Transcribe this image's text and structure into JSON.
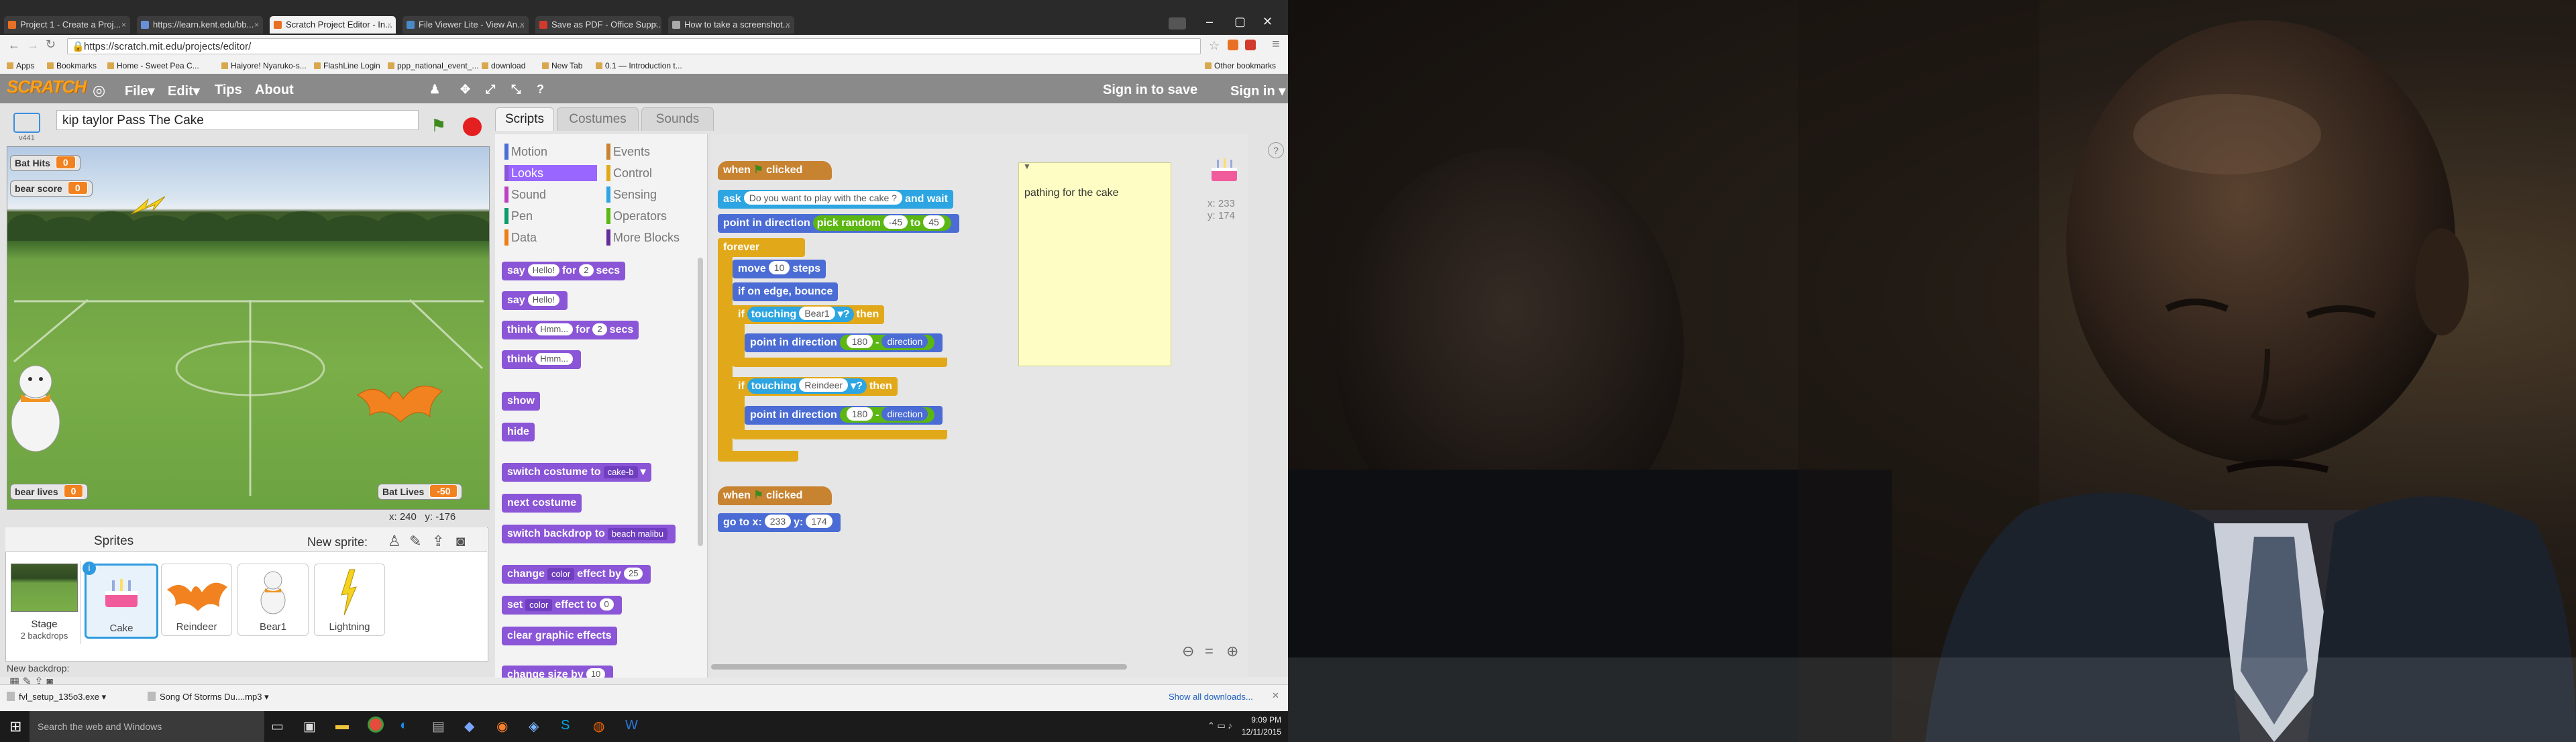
{
  "browser": {
    "tabs": [
      "Project 1 - Create a Proj...",
      "https://learn.kent.edu/bb...",
      "Scratch Project Editor - In...",
      "File Viewer Lite - View An...",
      "Save as PDF - Office Supp...",
      "How to take a screenshot..."
    ],
    "url": "https://scratch.mit.edu/projects/editor/",
    "bookmarks": [
      "Apps",
      "Bookmarks",
      "Home - Sweet Pea C...",
      "Haiyore! Nyaruko-s...",
      "FlashLine Login",
      "ppp_national_event_...",
      "download",
      "New Tab",
      "0.1 — Introduction t..."
    ],
    "other_bookmarks": "Other bookmarks"
  },
  "scratch": {
    "logo": "SCRATCH",
    "menu": [
      "File▾",
      "Edit▾",
      "Tips",
      "About"
    ],
    "sign_in_to_save": "Sign in to save",
    "sign_in": "Sign in ▾",
    "project_title": "kip taylor Pass The Cake",
    "version": "v441",
    "monitors": [
      {
        "label": "Bat Hits",
        "value": "0"
      },
      {
        "label": "bear score",
        "value": "0"
      },
      {
        "label": "bear lives",
        "value": "0"
      },
      {
        "label": "Bat Lives",
        "value": "-50"
      }
    ],
    "stage_coords": {
      "x_label": "x: 240",
      "y_label": "y: -176"
    },
    "sprites_header": "Sprites",
    "new_sprite": "New sprite:",
    "stage_thumb": {
      "name": "Stage",
      "sub": "2 backdrops"
    },
    "sprites": [
      "Cake",
      "Reindeer",
      "Bear1",
      "Lightning"
    ],
    "new_backdrop": "New backdrop:",
    "tabs": [
      "Scripts",
      "Costumes",
      "Sounds"
    ],
    "categories": [
      {
        "name": "Motion",
        "color": "#4a6cd4"
      },
      {
        "name": "Looks",
        "color": "#8a55d7"
      },
      {
        "name": "Sound",
        "color": "#bb42c3"
      },
      {
        "name": "Pen",
        "color": "#0e9a6c"
      },
      {
        "name": "Data",
        "color": "#ee7d16"
      },
      {
        "name": "Events",
        "color": "#c88330"
      },
      {
        "name": "Control",
        "color": "#e1a91a"
      },
      {
        "name": "Sensing",
        "color": "#2ca5e2"
      },
      {
        "name": "Operators",
        "color": "#5cb712"
      },
      {
        "name": "More Blocks",
        "color": "#632d99"
      }
    ],
    "palette_blocks": {
      "say_for": {
        "a": "say",
        "v1": "Hello!",
        "b": "for",
        "v2": "2",
        "c": "secs"
      },
      "say": {
        "a": "say",
        "v1": "Hello!"
      },
      "think_for": {
        "a": "think",
        "v1": "Hmm...",
        "b": "for",
        "v2": "2",
        "c": "secs"
      },
      "think": {
        "a": "think",
        "v1": "Hmm..."
      },
      "show": "show",
      "hide": "hide",
      "switch_costume": {
        "a": "switch costume to",
        "v1": "cake-b"
      },
      "next_costume": "next costume",
      "switch_backdrop": {
        "a": "switch backdrop to",
        "v1": "beach malibu"
      },
      "change_effect": {
        "a": "change",
        "v1": "color",
        "b": "effect by",
        "v2": "25"
      },
      "set_effect": {
        "a": "set",
        "v1": "color",
        "b": "effect to",
        "v2": "0"
      },
      "clear_effects": "clear graphic effects",
      "change_size": {
        "a": "change size by",
        "v1": "10"
      }
    },
    "script": {
      "when": "when",
      "clicked": "clicked",
      "ask": {
        "a": "ask",
        "v1": "Do you want to play with the cake ?",
        "b": "and wait"
      },
      "point_random": {
        "a": "point in direction",
        "b": "pick random",
        "v1": "-45",
        "c": "to",
        "v2": "45"
      },
      "forever": "forever",
      "move": {
        "a": "move",
        "v1": "10",
        "b": "steps"
      },
      "bounce": "if on edge, bounce",
      "if1": {
        "a": "if",
        "b": "touching",
        "v1": "Bear1",
        "c": "?",
        "d": "then"
      },
      "point1": {
        "a": "point in direction",
        "v1": "180",
        "b": "-",
        "c": "direction"
      },
      "if2": {
        "a": "if",
        "b": "touching",
        "v1": "Reindeer",
        "c": "?",
        "d": "then"
      },
      "point2": {
        "a": "point in direction",
        "v1": "180",
        "b": "-",
        "c": "direction"
      },
      "goto": {
        "a": "go to x:",
        "v1": "233",
        "b": "y:",
        "v2": "174"
      }
    },
    "note": "pathing for the cake",
    "sprite_pos": {
      "x": "x: 233",
      "y": "y: 174"
    }
  },
  "downloads": {
    "items": [
      "fvl_setup_135o3.exe",
      "Song Of Storms Du....mp3"
    ],
    "show_all": "Show all downloads..."
  },
  "taskbar": {
    "search": "Search the web and Windows",
    "time": "9:09 PM",
    "date": "12/11/2015"
  }
}
